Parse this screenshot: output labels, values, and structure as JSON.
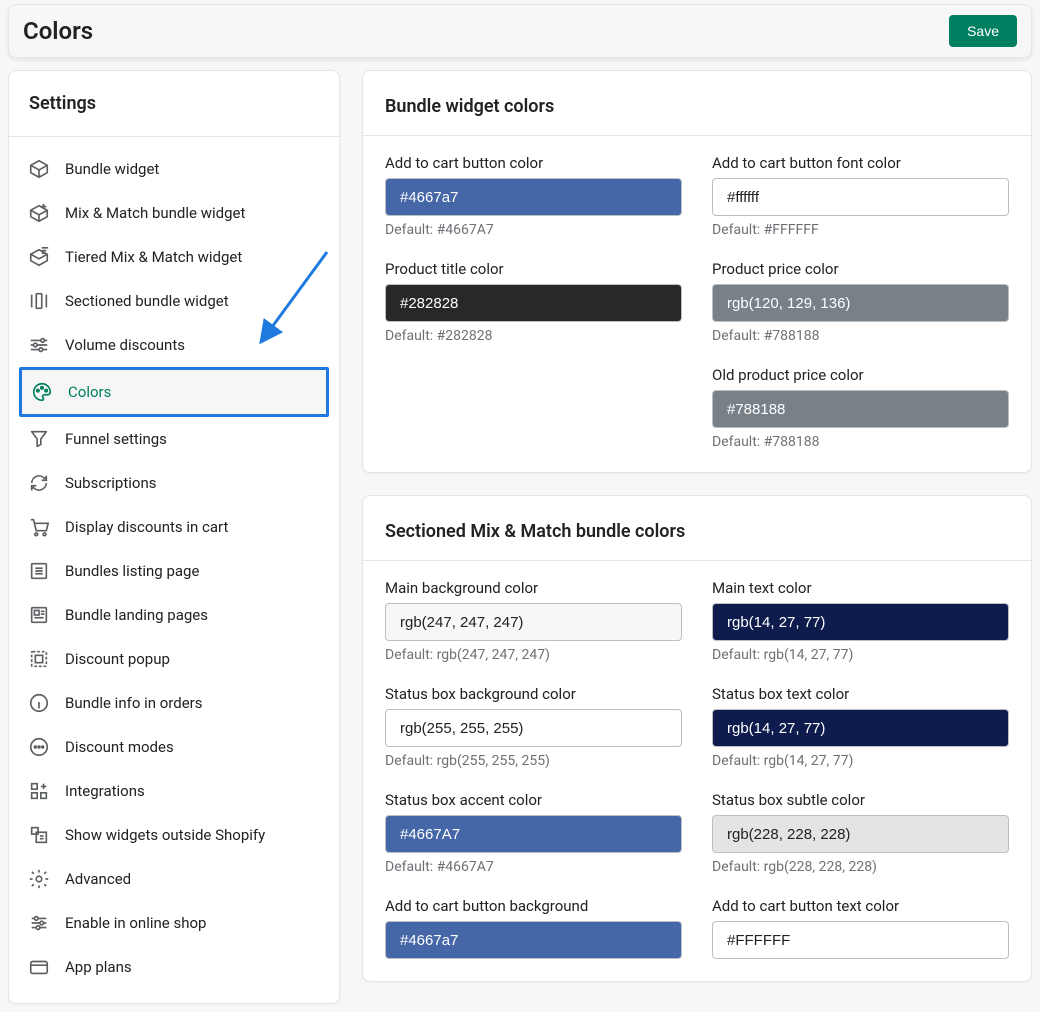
{
  "header": {
    "title": "Colors",
    "save_label": "Save"
  },
  "sidebar": {
    "heading": "Settings",
    "items": [
      {
        "label": "Bundle widget",
        "icon": "box",
        "active": false
      },
      {
        "label": "Mix & Match bundle widget",
        "icon": "box-plus",
        "active": false
      },
      {
        "label": "Tiered Mix & Match widget",
        "icon": "box-lines",
        "active": false
      },
      {
        "label": "Sectioned bundle widget",
        "icon": "sections",
        "active": false
      },
      {
        "label": "Volume discounts",
        "icon": "volume",
        "active": false
      },
      {
        "label": "Colors",
        "icon": "palette",
        "active": true
      },
      {
        "label": "Funnel settings",
        "icon": "funnel",
        "active": false
      },
      {
        "label": "Subscriptions",
        "icon": "refresh",
        "active": false
      },
      {
        "label": "Display discounts in cart",
        "icon": "cart",
        "active": false
      },
      {
        "label": "Bundles listing page",
        "icon": "list",
        "active": false
      },
      {
        "label": "Bundle landing pages",
        "icon": "landing",
        "active": false
      },
      {
        "label": "Discount popup",
        "icon": "popup",
        "active": false
      },
      {
        "label": "Bundle info in orders",
        "icon": "info",
        "active": false
      },
      {
        "label": "Discount modes",
        "icon": "modes",
        "active": false
      },
      {
        "label": "Integrations",
        "icon": "apps",
        "active": false
      },
      {
        "label": "Show widgets outside Shopify",
        "icon": "external",
        "active": false
      },
      {
        "label": "Advanced",
        "icon": "gear",
        "active": false
      },
      {
        "label": "Enable in online shop",
        "icon": "sliders",
        "active": false
      },
      {
        "label": "App plans",
        "icon": "card",
        "active": false
      }
    ]
  },
  "cards": [
    {
      "title": "Bundle widget colors",
      "fields": [
        [
          {
            "label": "Add to cart button color",
            "value": "#4667a7",
            "bg": "#4667a7",
            "text_white": true,
            "default": "Default: #4667A7"
          },
          {
            "label": "Add to cart button font color",
            "value": "#ffffff",
            "bg": "#ffffff",
            "text_white": false,
            "default": "Default: #FFFFFF"
          }
        ],
        [
          {
            "label": "Product title color",
            "value": "#282828",
            "bg": "#282828",
            "text_white": true,
            "default": "Default: #282828"
          },
          {
            "label": "Product price color",
            "value": "rgb(120, 129, 136)",
            "bg": "rgb(120,129,136)",
            "text_white": true,
            "default": "Default: #788188"
          }
        ],
        [
          null,
          {
            "label": "Old product price color",
            "value": "#788188",
            "bg": "#788188",
            "text_white": true,
            "default": "Default: #788188"
          }
        ]
      ]
    },
    {
      "title": "Sectioned Mix & Match bundle colors",
      "fields": [
        [
          {
            "label": "Main background color",
            "value": "rgb(247, 247, 247)",
            "bg": "rgb(247,247,247)",
            "text_white": false,
            "default": "Default: rgb(247, 247, 247)"
          },
          {
            "label": "Main text color",
            "value": "rgb(14, 27, 77)",
            "bg": "rgb(14,27,77)",
            "text_white": true,
            "default": "Default: rgb(14, 27, 77)"
          }
        ],
        [
          {
            "label": "Status box background color",
            "value": "rgb(255, 255, 255)",
            "bg": "rgb(255,255,255)",
            "text_white": false,
            "default": "Default: rgb(255, 255, 255)"
          },
          {
            "label": "Status box text color",
            "value": "rgb(14, 27, 77)",
            "bg": "rgb(14,27,77)",
            "text_white": true,
            "default": "Default: rgb(14, 27, 77)"
          }
        ],
        [
          {
            "label": "Status box accent color",
            "value": "#4667A7",
            "bg": "#4667A7",
            "text_white": true,
            "default": "Default: #4667A7"
          },
          {
            "label": "Status box subtle color",
            "value": "rgb(228, 228, 228)",
            "bg": "rgb(228,228,228)",
            "text_white": false,
            "default": "Default: rgb(228, 228, 228)"
          }
        ],
        [
          {
            "label": "Add to cart button background",
            "value": "#4667a7",
            "bg": "#4667A7",
            "text_white": true,
            "default": ""
          },
          {
            "label": "Add to cart button text color",
            "value": "#FFFFFF",
            "bg": "#ffffff",
            "text_white": false,
            "default": ""
          }
        ]
      ]
    }
  ]
}
